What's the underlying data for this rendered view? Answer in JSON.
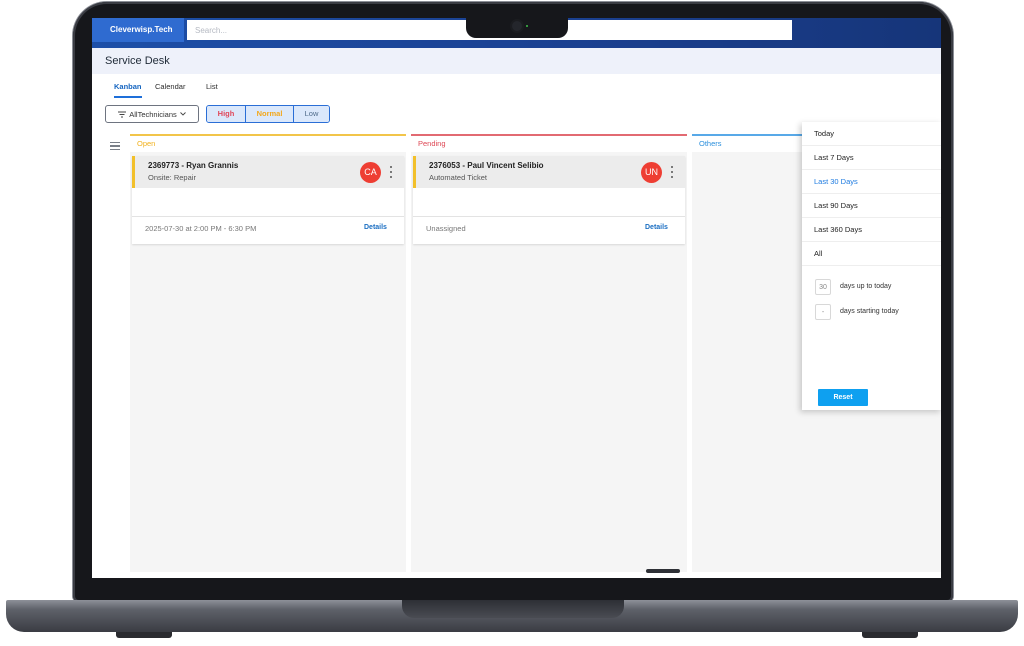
{
  "app": {
    "brand": "Cleverwisp.Tech",
    "search_placeholder": "Search..."
  },
  "header": {
    "title": "Service Desk"
  },
  "tabs": [
    {
      "label": "Kanban",
      "active": true
    },
    {
      "label": "Calendar",
      "active": false
    },
    {
      "label": "List",
      "active": false
    }
  ],
  "filters": {
    "technicians_label": "AllTechnicians",
    "priority": [
      {
        "label": "High",
        "color": "#e0475a"
      },
      {
        "label": "Normal",
        "color": "#f3a81c"
      },
      {
        "label": "Low",
        "color": "#4f6b8a"
      }
    ]
  },
  "columns": [
    {
      "title": "Open",
      "color": "#f2b11c",
      "cards": [
        {
          "title": "2369773 - Ryan Grannis",
          "subtitle": "Onsite: Repair",
          "avatar": "CA",
          "footer": "2025-07-30 at 2:00 PM - 6:30 PM",
          "link": "Details"
        }
      ]
    },
    {
      "title": "Pending",
      "color": "#de4855",
      "cards": [
        {
          "title": "2376053 - Paul Vincent Selibio",
          "subtitle": "Automated Ticket",
          "avatar": "UN",
          "footer": "Unassigned",
          "link": "Details"
        }
      ]
    },
    {
      "title": "Others",
      "color": "#2b8fdc",
      "cards": []
    }
  ],
  "date_dropdown": {
    "options": [
      {
        "label": "Today",
        "active": false
      },
      {
        "label": "Last 7 Days",
        "active": false
      },
      {
        "label": "Last 30 Days",
        "active": true
      },
      {
        "label": "Last 90 Days",
        "active": false
      },
      {
        "label": "Last 360 Days",
        "active": false
      },
      {
        "label": "All",
        "active": false
      }
    ],
    "custom": [
      {
        "value": "30",
        "text": "days up to today"
      },
      {
        "value": "-",
        "text": "days starting today"
      }
    ],
    "reset_label": "Reset"
  }
}
